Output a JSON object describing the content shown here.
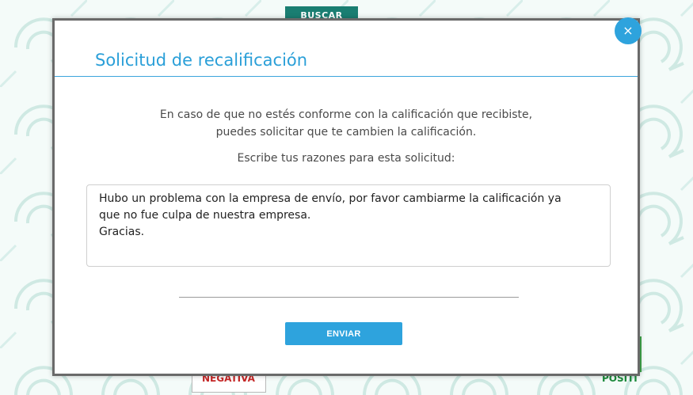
{
  "background": {
    "search_button_label": "BUSCAR",
    "negative_label": "NEGATIVA",
    "positive_label": "POSITI"
  },
  "modal": {
    "title": "Solicitud de recalificación",
    "intro_line_1": "En caso de que no estés conforme con la calificación que recibiste,",
    "intro_line_2": "puedes solicitar que te cambien la calificación.",
    "prompt": "Escribe tus razones para esta solicitud:",
    "reason_text": "Hubo un problema con la empresa de envío, por favor cambiarme la calificación ya\nque no fue culpa de nuestra empresa.\nGracias.",
    "send_label": "ENVIAR",
    "close_symbol": "×"
  },
  "colors": {
    "accent": "#2ea3dd",
    "title": "#2a9fd8",
    "modal_border": "#6a6a6a"
  },
  "icons": {
    "close": "close-icon"
  }
}
